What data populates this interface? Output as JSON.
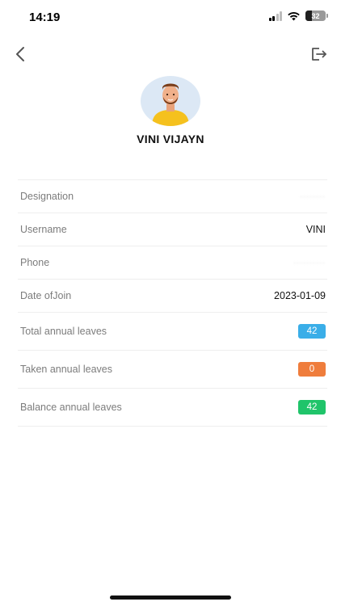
{
  "status_bar": {
    "time": "14:19",
    "battery_level": "32",
    "signal_icon": "cellular-signal-icon",
    "wifi_icon": "wifi-icon"
  },
  "nav": {
    "back_icon": "chevron-left-icon",
    "logout_icon": "logout-icon"
  },
  "profile": {
    "avatar_icon": "user-avatar-illustration",
    "name": "VINI VIJAYN"
  },
  "details": [
    {
      "label": "Designation",
      "value": "········",
      "masked": true
    },
    {
      "label": "Username",
      "value": "VINI",
      "masked": false
    },
    {
      "label": "Phone",
      "value": "··········",
      "masked": true
    },
    {
      "label": "Date ofJoin",
      "value": "2023-01-09",
      "masked": false
    }
  ],
  "leaves": [
    {
      "label": "Total annual leaves",
      "value": "42",
      "color": "#3aaee8"
    },
    {
      "label": "Taken annual leaves",
      "value": "0",
      "color": "#ef7d3c"
    },
    {
      "label": "Balance annual leaves",
      "value": "42",
      "color": "#20c46a"
    }
  ]
}
